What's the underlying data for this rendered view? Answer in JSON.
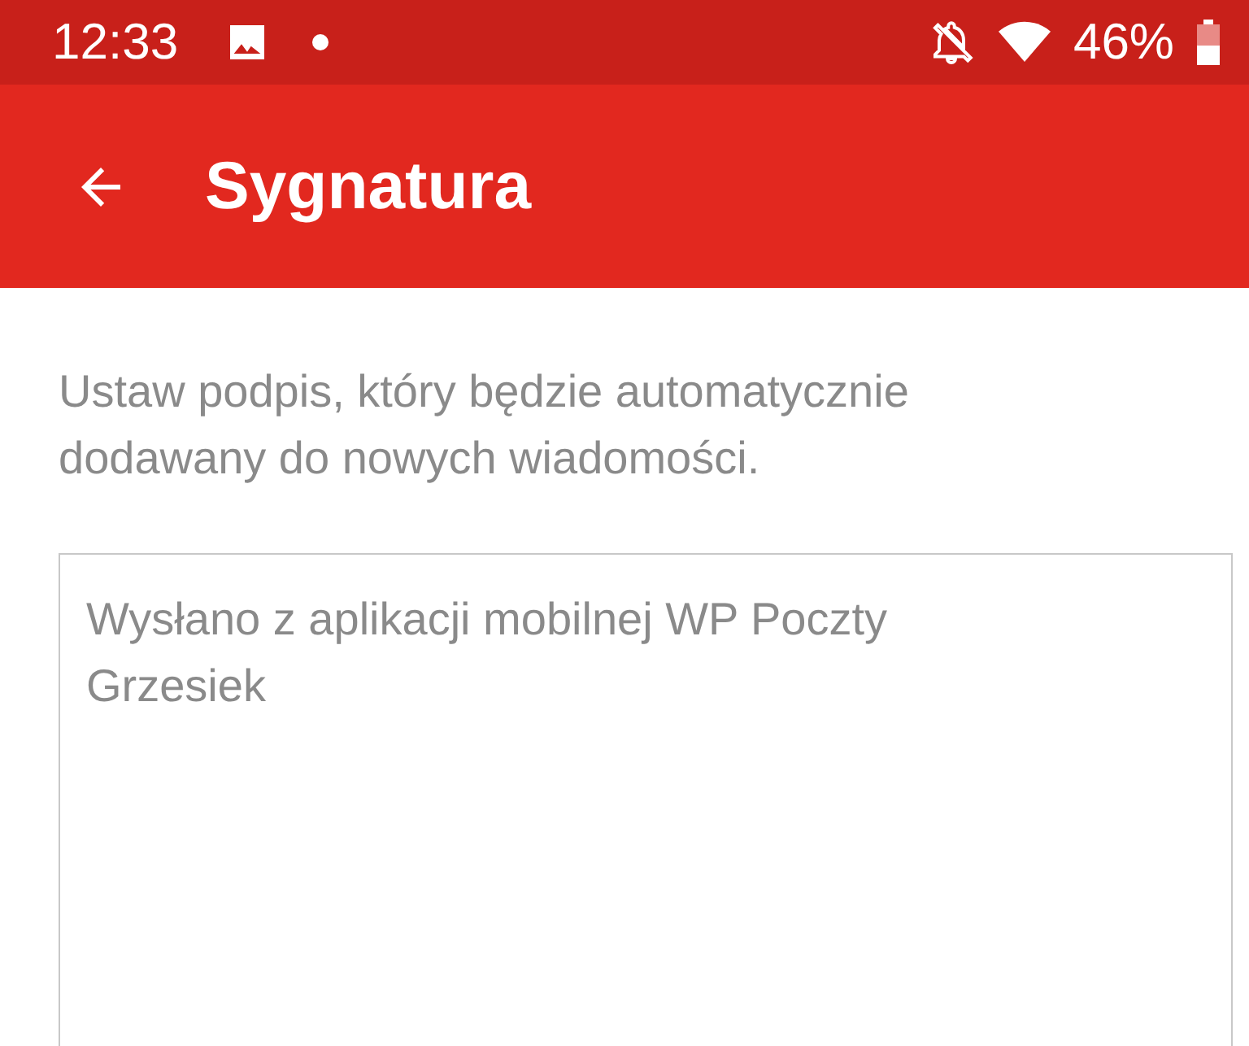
{
  "status_bar": {
    "time": "12:33",
    "battery_percent": "46%"
  },
  "app_bar": {
    "title": "Sygnatura"
  },
  "description": "Ustaw podpis, który będzie automatycznie dodawany do nowych wiadomości.",
  "signature_field": {
    "value": "Wysłano z aplikacji mobilnej WP Poczty\nGrzesiek"
  }
}
